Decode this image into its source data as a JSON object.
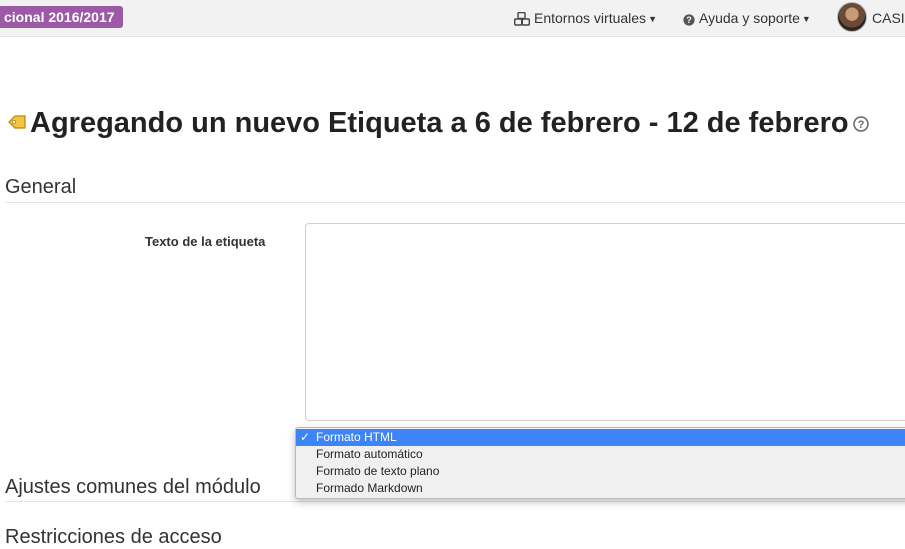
{
  "topbar": {
    "badge": "cional 2016/2017",
    "envs_label": "Entornos virtuales",
    "help_label": "Ayuda y soporte",
    "user_label": "CASI"
  },
  "page": {
    "title": "Agregando un nuevo Etiqueta a 6 de febrero - 12 de febrero"
  },
  "sections": {
    "general": "General",
    "ajustes": "Ajustes comunes del módulo",
    "restricciones": "Restricciones de acceso"
  },
  "form": {
    "label_text": "Texto de la etiqueta",
    "textarea_value": ""
  },
  "format_dropdown": {
    "check": "✓",
    "options": [
      "Formato HTML",
      "Formato automático",
      "Formato de texto plano",
      "Formado Markdown"
    ],
    "selected": "Formato HTML"
  },
  "colors": {
    "badge": "#9b59a6",
    "selection": "#3d84f6"
  },
  "icons": {
    "envs": "cubes-icon",
    "help": "question-circle-icon",
    "title": "tag-icon",
    "title_help": "help-circle-icon",
    "user": "avatar"
  }
}
